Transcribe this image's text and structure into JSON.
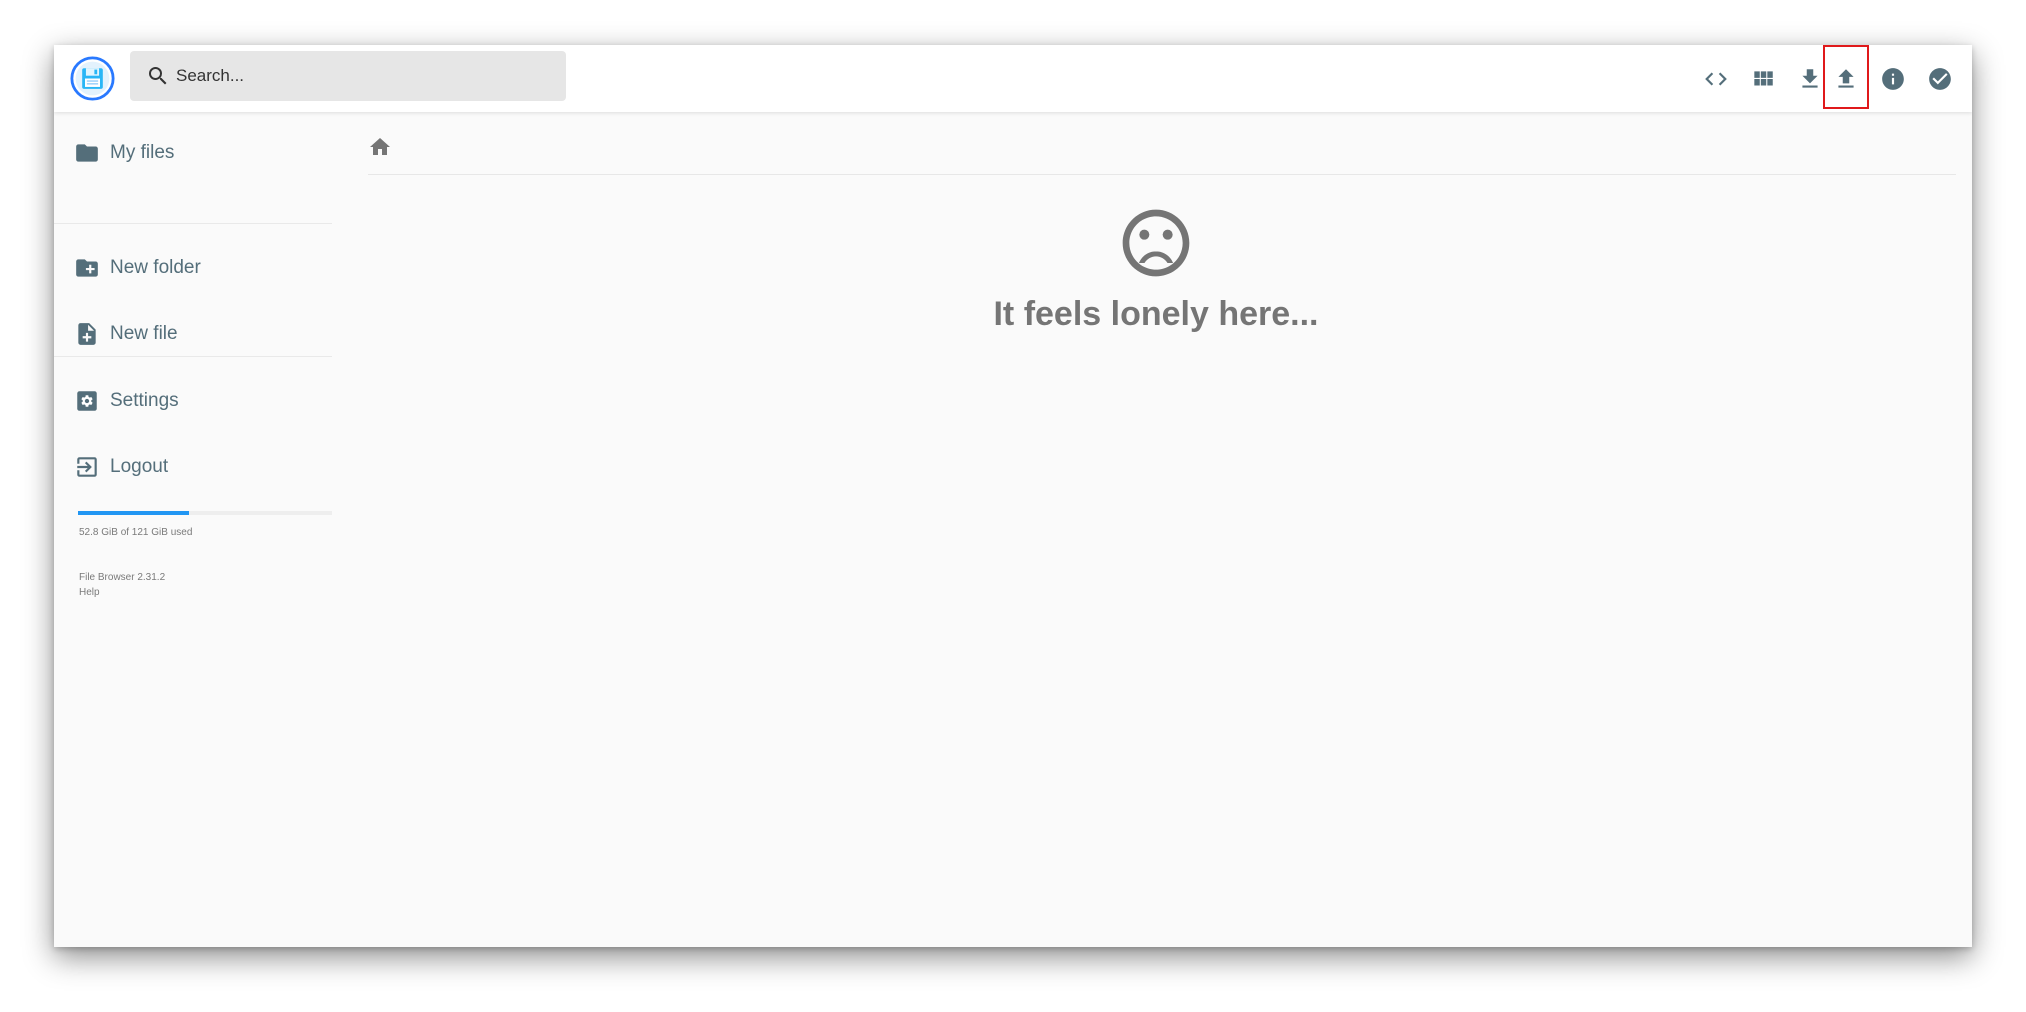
{
  "search": {
    "placeholder": "Search..."
  },
  "toolbar": {
    "buttons": [
      {
        "name": "toggle-code-button",
        "icon": "code-icon"
      },
      {
        "name": "toggle-view-button",
        "icon": "grid-view-icon"
      },
      {
        "name": "download-button",
        "icon": "download-icon"
      },
      {
        "name": "upload-button",
        "icon": "upload-icon",
        "highlighted": true
      },
      {
        "name": "info-button",
        "icon": "info-icon"
      },
      {
        "name": "select-button",
        "icon": "check-circle-icon"
      }
    ]
  },
  "sidebar": {
    "items": [
      {
        "label": "My files",
        "icon": "folder-icon"
      },
      {
        "label": "New folder",
        "icon": "create-new-folder-icon"
      },
      {
        "label": "New file",
        "icon": "note-add-icon"
      },
      {
        "label": "Settings",
        "icon": "settings-icon"
      },
      {
        "label": "Logout",
        "icon": "exit-icon"
      }
    ],
    "quota": {
      "text": "52.8 GiB of 121 GiB used",
      "used_fraction": 0.436
    },
    "version": "File Browser 2.31.2",
    "help": "Help"
  },
  "main": {
    "breadcrumb_icon": "home-icon",
    "empty_icon": "sentiment-dissatisfied-icon",
    "empty_message": "It feels lonely here..."
  },
  "colors": {
    "accent": "#2196f3",
    "icon": "#546e7a",
    "highlight": "#e0191b",
    "empty_text": "#757575"
  }
}
